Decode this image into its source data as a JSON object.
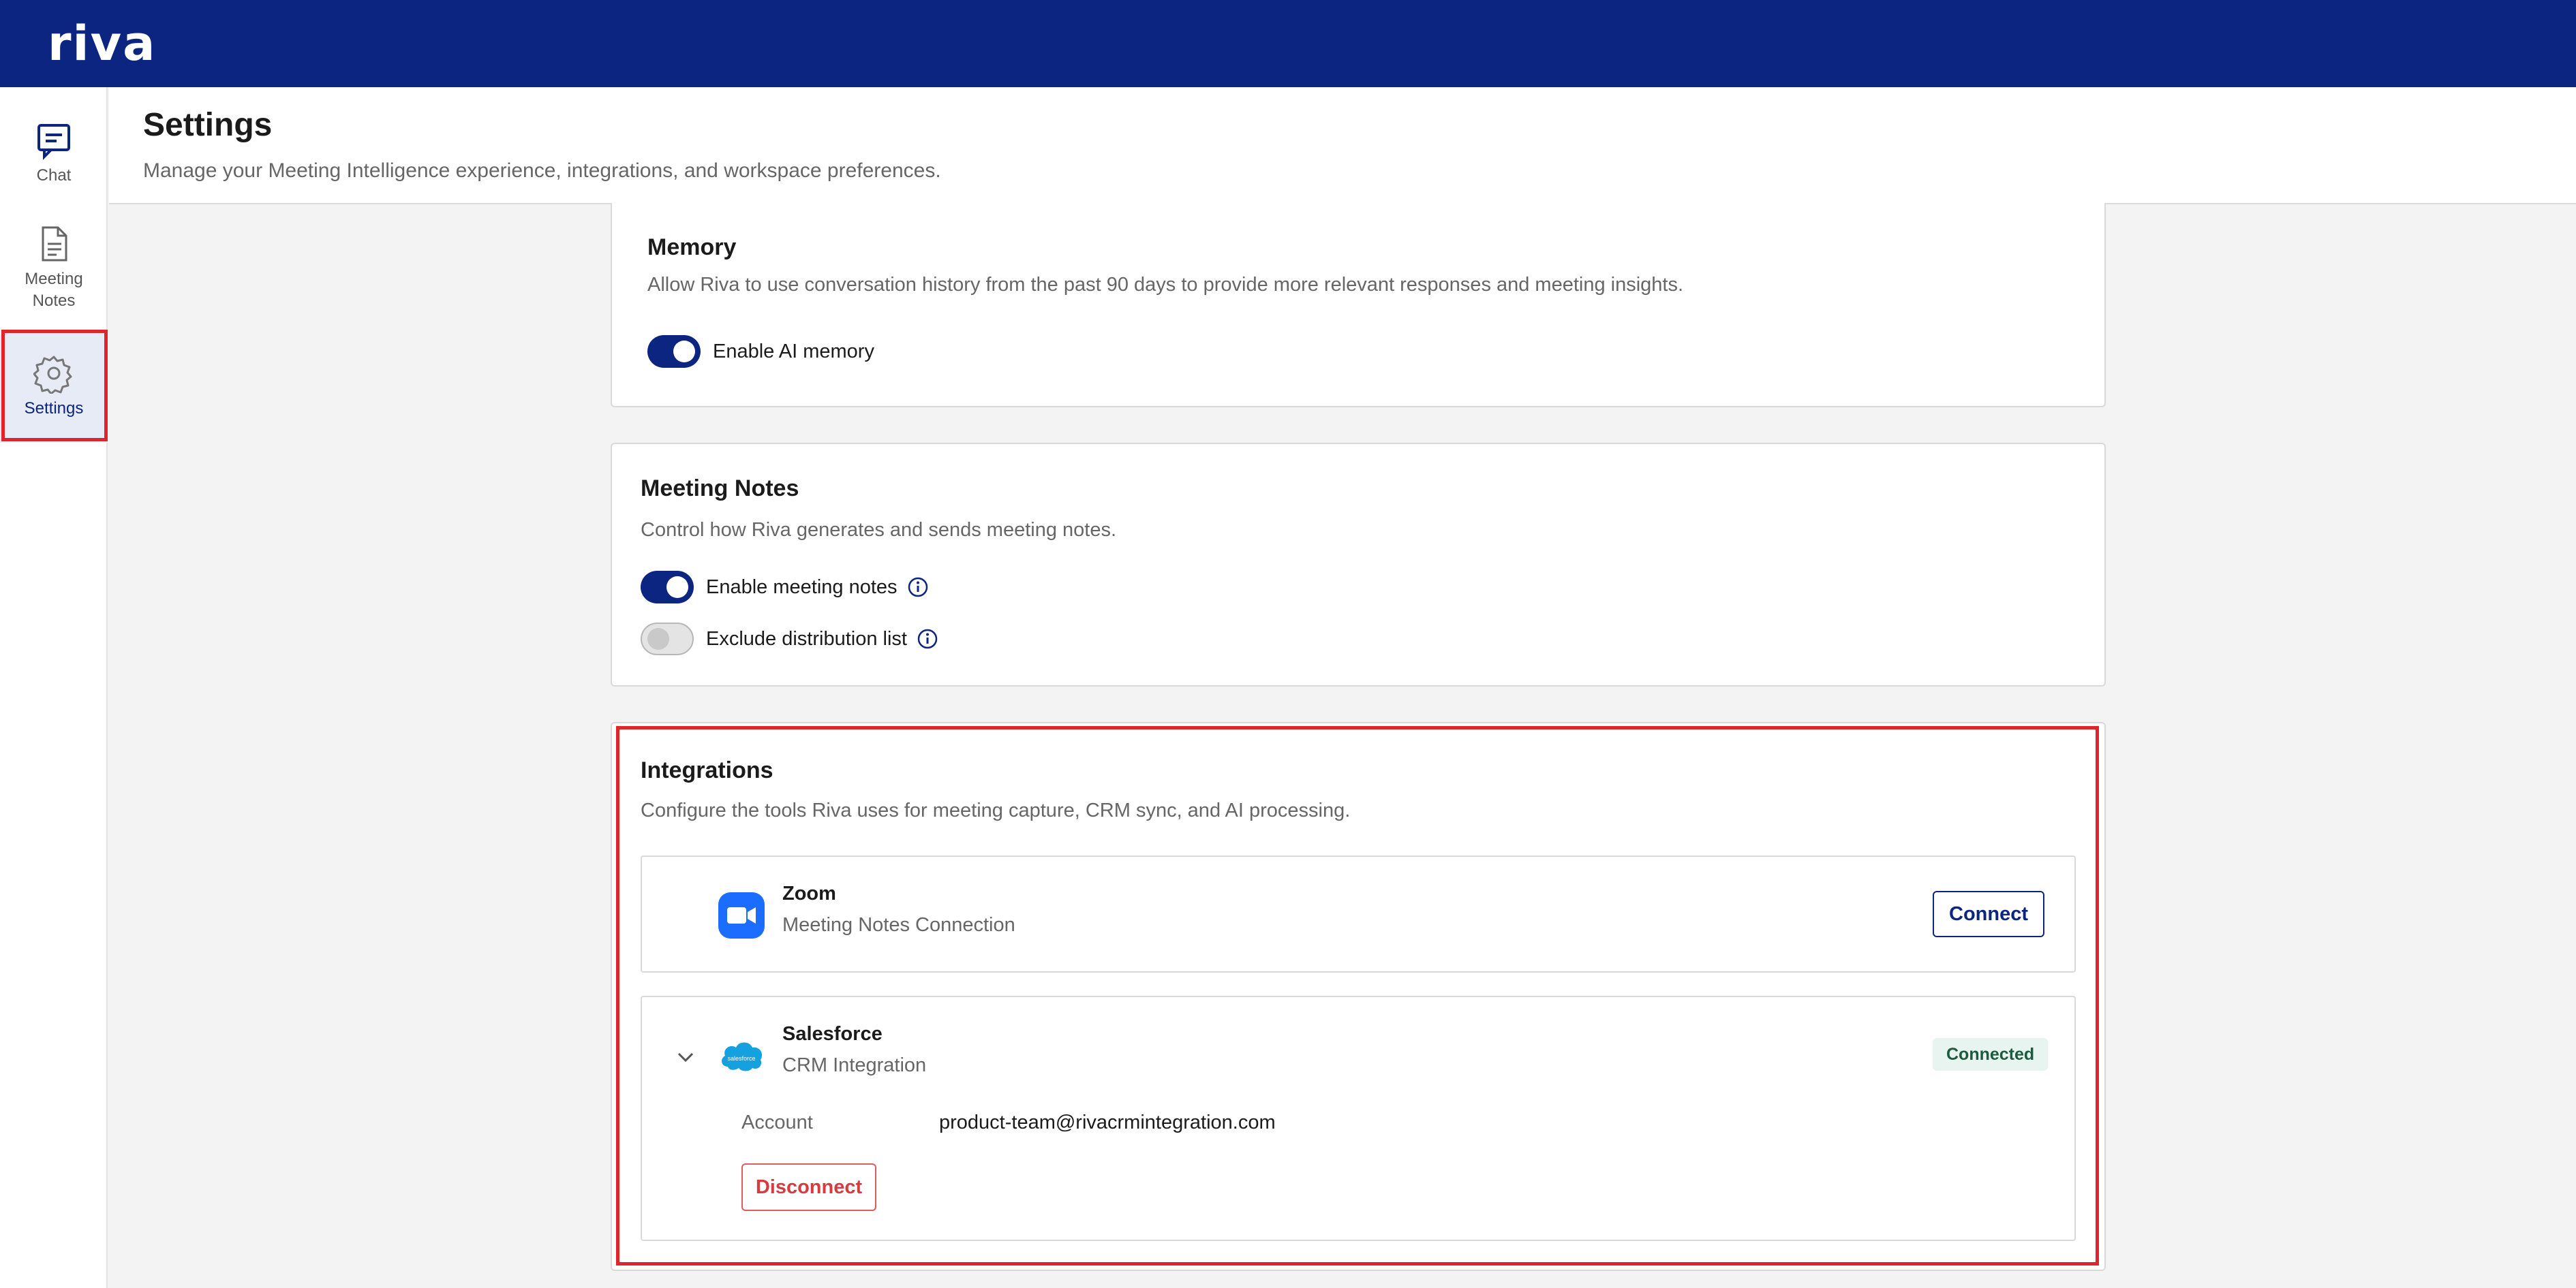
{
  "app": {
    "logo_text": "riva"
  },
  "sidebar": {
    "items": [
      {
        "label": "Chat",
        "icon": "chat-icon"
      },
      {
        "label": "Meeting Notes",
        "icon": "document-icon"
      },
      {
        "label": "Settings",
        "icon": "gear-icon",
        "active": true
      }
    ]
  },
  "header": {
    "title": "Settings",
    "subtitle": "Manage your Meeting Intelligence experience, integrations, and workspace preferences."
  },
  "memory": {
    "title": "Memory",
    "description": "Allow Riva to use conversation history from the past 90 days to provide more relevant responses and meeting insights.",
    "toggle_label": "Enable AI memory",
    "enabled": true
  },
  "meeting_notes": {
    "title": "Meeting Notes",
    "description": "Control how Riva generates and sends meeting notes.",
    "toggles": [
      {
        "label": "Enable meeting notes",
        "enabled": true
      },
      {
        "label": "Exclude distribution list",
        "enabled": false
      }
    ]
  },
  "integrations": {
    "title": "Integrations",
    "description": "Configure the tools Riva uses for meeting capture, CRM sync, and AI processing.",
    "zoom": {
      "name": "Zoom",
      "type": "Meeting Notes Connection",
      "button_label": "Connect"
    },
    "salesforce": {
      "name": "Salesforce",
      "type": "CRM Integration",
      "status": "Connected",
      "account_label": "Account",
      "account_value": "product-team@rivacrmintegration.com",
      "disconnect_label": "Disconnect",
      "logo_text": "salesforce"
    }
  },
  "colors": {
    "brand": "#0c2580",
    "highlight": "#e0242b",
    "zoom_blue": "#1a6dff",
    "salesforce_blue": "#15a1e0"
  }
}
